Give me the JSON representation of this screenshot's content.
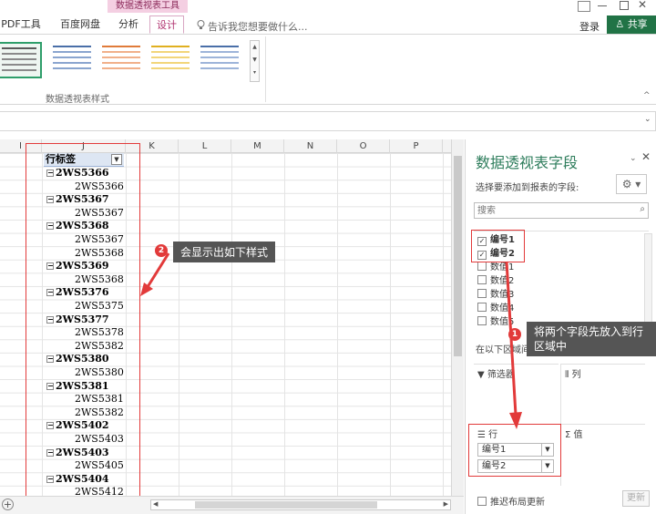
{
  "ribbon": {
    "context_title": "数据透视表工具",
    "tabs": [
      {
        "label": "PDF工具集"
      },
      {
        "label": "百度网盘"
      },
      {
        "label": "分析"
      },
      {
        "label": "设计"
      }
    ],
    "tell_me": "告诉我您想要做什么...",
    "login": "登录",
    "share": "共享",
    "gallery_label": "数据透视表样式"
  },
  "sheet": {
    "columns": [
      "I",
      "J",
      "K",
      "L",
      "M",
      "N",
      "O",
      "P"
    ],
    "header_label": "行标签",
    "rows": [
      {
        "text": "2WS5366",
        "level": 0
      },
      {
        "text": "2WS5366",
        "level": 1
      },
      {
        "text": "2WS5367",
        "level": 0
      },
      {
        "text": "2WS5367",
        "level": 1
      },
      {
        "text": "2WS5368",
        "level": 0
      },
      {
        "text": "2WS5367",
        "level": 1
      },
      {
        "text": "2WS5368",
        "level": 1
      },
      {
        "text": "2WS5369",
        "level": 0
      },
      {
        "text": "2WS5368",
        "level": 1
      },
      {
        "text": "2WS5376",
        "level": 0
      },
      {
        "text": "2WS5375",
        "level": 1
      },
      {
        "text": "2WS5377",
        "level": 0
      },
      {
        "text": "2WS5378",
        "level": 1
      },
      {
        "text": "2WS5382",
        "level": 1
      },
      {
        "text": "2WS5380",
        "level": 0
      },
      {
        "text": "2WS5380",
        "level": 1
      },
      {
        "text": "2WS5381",
        "level": 0
      },
      {
        "text": "2WS5381",
        "level": 1
      },
      {
        "text": "2WS5382",
        "level": 1
      },
      {
        "text": "2WS5402",
        "level": 0
      },
      {
        "text": "2WS5403",
        "level": 1
      },
      {
        "text": "2WS5403",
        "level": 0
      },
      {
        "text": "2WS5405",
        "level": 1
      },
      {
        "text": "2WS5404",
        "level": 0
      },
      {
        "text": "2WS5412",
        "level": 1
      }
    ]
  },
  "callouts": {
    "c1_badge": "1",
    "c1_text_line1": "将两个字段先放入到行",
    "c1_text_line2": "区域中",
    "c2_badge": "2",
    "c2_text": "会显示出如下样式"
  },
  "pane": {
    "title": "数据透视表字段",
    "subtitle": "选择要添加到报表的字段:",
    "search_placeholder": "搜索",
    "fields": [
      {
        "label": "编号1",
        "checked": true
      },
      {
        "label": "编号2",
        "checked": true
      },
      {
        "label": "数值1",
        "checked": false
      },
      {
        "label": "数值2",
        "checked": false
      },
      {
        "label": "数值3",
        "checked": false
      },
      {
        "label": "数值4",
        "checked": false
      },
      {
        "label": "数值5",
        "checked": false
      }
    ],
    "areas_hint": "在以下区域间",
    "areas": {
      "filters": "筛选器",
      "columns": "列",
      "rows": "行",
      "values": "值"
    },
    "row_items": [
      "编号1",
      "编号2"
    ],
    "defer_label": "推迟布局更新",
    "update_label": "更新"
  },
  "colors": {
    "accent_green": "#217346",
    "pane_title": "#2e7d5c",
    "highlight_red": "#e23a3a",
    "context_tab": "#b0306e"
  }
}
